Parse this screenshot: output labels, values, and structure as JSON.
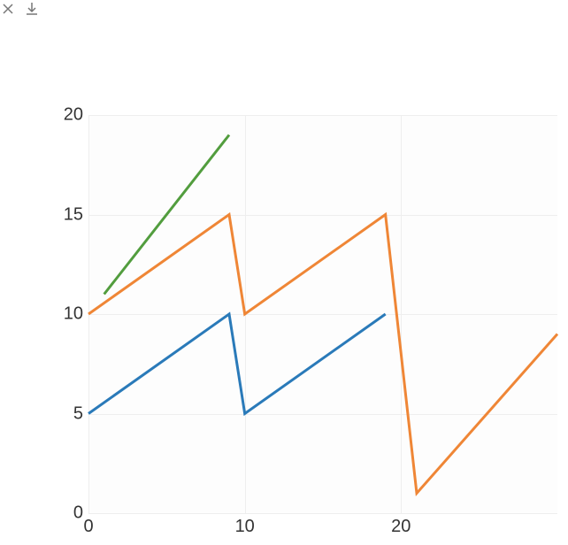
{
  "toolbar": {
    "clear_icon": "clear-icon",
    "download_icon": "download-icon"
  },
  "chart_data": {
    "type": "line",
    "title": "",
    "xlabel": "",
    "ylabel": "",
    "xlim": [
      0,
      30
    ],
    "ylim": [
      0,
      20
    ],
    "xticks": [
      "0",
      "10",
      "20"
    ],
    "yticks": [
      "0",
      "5",
      "10",
      "15",
      "20"
    ],
    "series": [
      {
        "name": "blue",
        "color": "#2a7ab9",
        "x": [
          0,
          9,
          10,
          19
        ],
        "y": [
          5,
          10,
          5,
          10
        ]
      },
      {
        "name": "orange",
        "color": "#ef8636",
        "x": [
          0,
          9,
          10,
          19,
          21,
          30
        ],
        "y": [
          10,
          15,
          10,
          15,
          1,
          9
        ]
      },
      {
        "name": "green",
        "color": "#529d3e",
        "x": [
          1,
          9
        ],
        "y": [
          11,
          19
        ]
      }
    ]
  }
}
